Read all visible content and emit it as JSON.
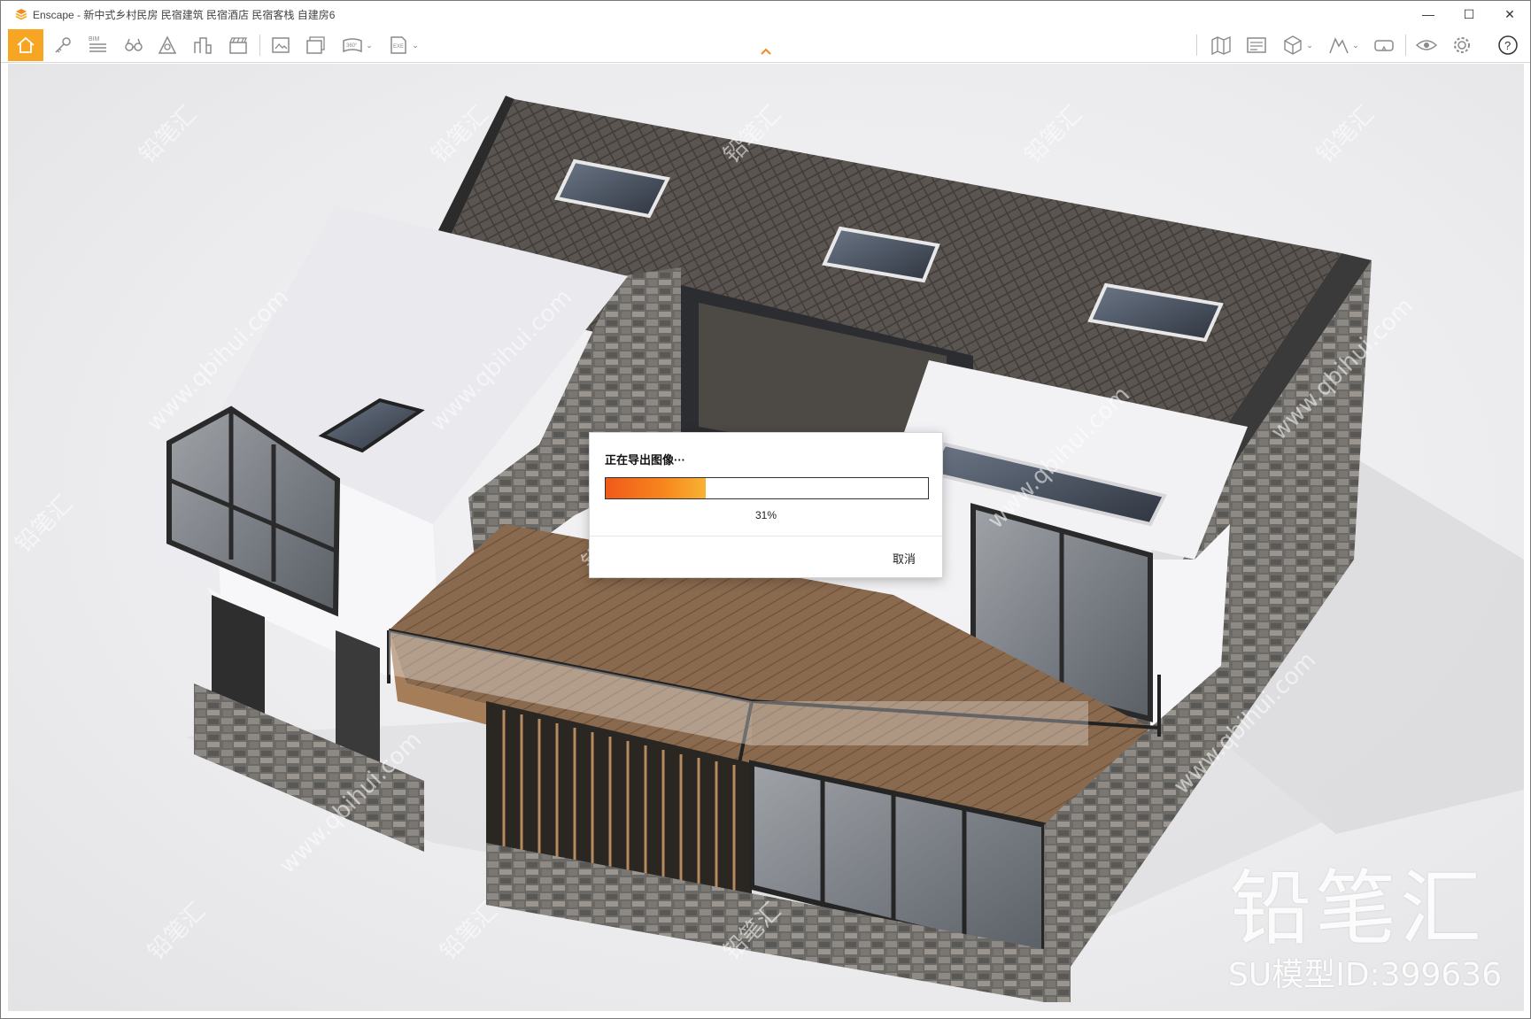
{
  "window": {
    "app_name": "Enscape",
    "title": "Enscape - 新中式乡村民房 民宿建筑 民宿酒店 民宿客栈 自建房6",
    "controls": {
      "minimize": "—",
      "maximize": "☐",
      "close": "✕"
    }
  },
  "toolbar": {
    "buttons": [
      {
        "name": "home",
        "icon": "home-icon",
        "active": true
      },
      {
        "name": "walk-mode",
        "icon": "key-icon"
      },
      {
        "name": "bim",
        "icon": "bim-icon",
        "label": "BIM"
      },
      {
        "name": "views",
        "icon": "binoculars-icon"
      },
      {
        "name": "atmosphere",
        "icon": "atmosphere-icon"
      },
      {
        "name": "materials",
        "icon": "buildings-icon"
      },
      {
        "name": "video-editor",
        "icon": "clapper-icon"
      },
      {
        "name": "screenshot",
        "icon": "image-export-icon"
      },
      {
        "name": "batch-render",
        "icon": "batch-export-icon"
      },
      {
        "name": "panorama",
        "icon": "panorama-icon",
        "label": "360°"
      },
      {
        "name": "exe-export",
        "icon": "exe-export-icon",
        "label": "EXE"
      },
      {
        "name": "map",
        "icon": "map-icon"
      },
      {
        "name": "visual-settings",
        "icon": "settings-panel-icon"
      },
      {
        "name": "asset-library",
        "icon": "cube-icon"
      },
      {
        "name": "site-context",
        "icon": "mountain-icon"
      },
      {
        "name": "vr-headset",
        "icon": "vr-icon"
      },
      {
        "name": "eye",
        "icon": "eye-icon"
      },
      {
        "name": "settings",
        "icon": "gear-icon"
      },
      {
        "name": "help",
        "icon": "help-icon",
        "label": "?"
      }
    ]
  },
  "watermark": {
    "brand": "铅笔汇",
    "model_id": "SU模型ID:399636",
    "site": "www.qbihui.com"
  },
  "dialog": {
    "title": "正在导出图像···",
    "progress": 0.31,
    "progress_label": "31%",
    "cancel_label": "取消"
  },
  "colors": {
    "accent": "#f6a623",
    "progress_start": "#f05a1a",
    "progress_end": "#f9b233"
  }
}
